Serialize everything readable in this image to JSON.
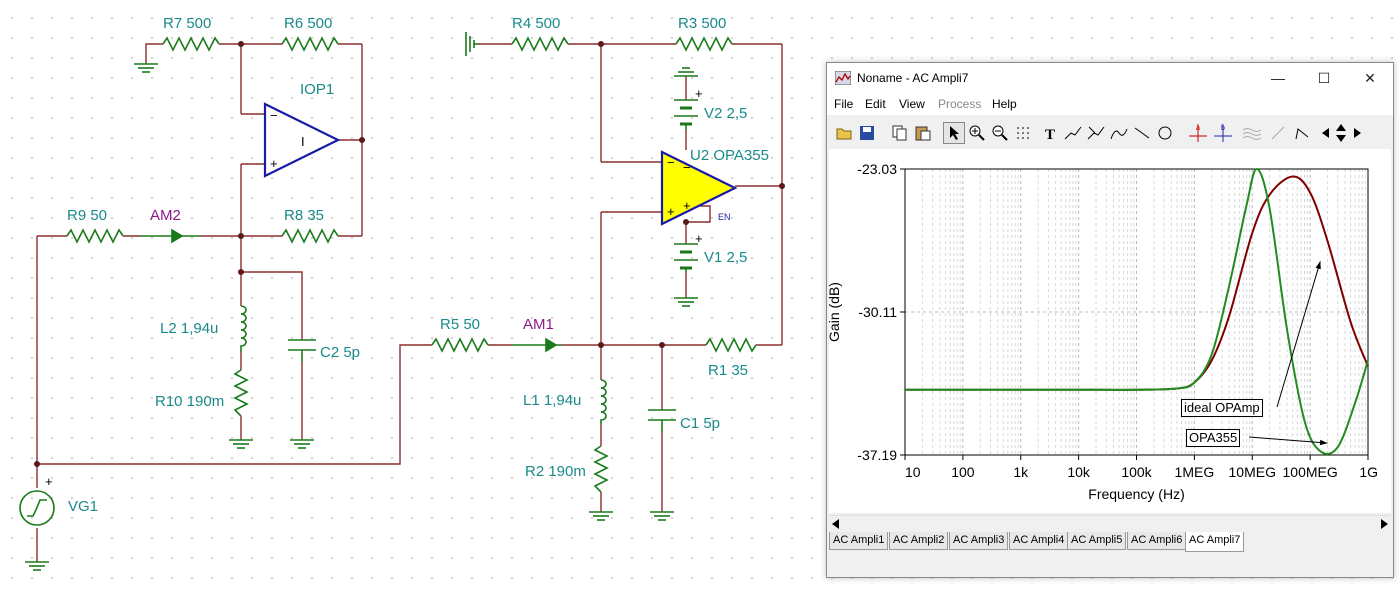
{
  "schematic": {
    "components": {
      "R7": "R7 500",
      "R6": "R6 500",
      "IOP1": "IOP1",
      "R9": "R9 50",
      "AM2": "AM2",
      "R8": "R8 35",
      "L2": "L2 1,94u",
      "C2": "C2 5p",
      "R10": "R10 190m",
      "VG1": "VG1",
      "R4": "R4 500",
      "R3": "R3 500",
      "V2": "V2 2,5",
      "U2": "U2 OPA355",
      "V1": "V1 2,5",
      "R5": "R5 50",
      "AM1": "AM1",
      "R1": "R1 35",
      "L1": "L1 1,94u",
      "C1": "C1 5p",
      "R2": "R2 190m"
    },
    "symbols": {
      "plus": "+",
      "minus": "−",
      "en": "EN",
      "iop_glyph": "I"
    },
    "colors": {
      "wire": "#8b2e2e",
      "label": "#1a8a8a",
      "meter_label": "#8b1a8b",
      "component": "#1a7a1a",
      "opamp_fill": "#ffff00",
      "opamp_stroke": "#1a1aaa"
    }
  },
  "window": {
    "title": "Noname - AC Ampli7",
    "controls": {
      "minimize": "—",
      "maximize": "☐",
      "close": "✕"
    },
    "menu": [
      "File",
      "Edit",
      "View",
      "Process",
      "Help"
    ],
    "menu_disabled": [
      "Process"
    ],
    "toolbar_icons": [
      "open-icon",
      "save-icon",
      "copy-icon",
      "paste-icon",
      "pointer-icon",
      "zoom-in-icon",
      "zoom-out-icon",
      "grid-icon",
      "text-icon",
      "cursor-a-icon",
      "cursor-b-icon",
      "curve-icon",
      "line-icon",
      "circle-icon",
      "cursor-a-cross-icon",
      "cursor-b-cross-icon",
      "waves-icon",
      "arrow-icon",
      "step-icon",
      "scroll-left-icon",
      "scroll-updown-icon",
      "scroll-right-icon"
    ],
    "tabs": [
      "AC Ampli1",
      "AC Ampli2",
      "AC Ampli3",
      "AC Ampli4",
      "AC Ampli5",
      "AC Ampli6",
      "AC Ampli7"
    ],
    "active_tab": "AC Ampli7"
  },
  "chart_data": {
    "type": "line",
    "xlabel": "Frequency (Hz)",
    "ylabel": "Gain (dB)",
    "x_scale": "log",
    "xlim": [
      10,
      1000000000
    ],
    "ylim": [
      -37.19,
      -23.03
    ],
    "x_tick_labels": [
      "10",
      "100",
      "1k",
      "10k",
      "100k",
      "1MEG",
      "10MEG",
      "100MEG",
      "1G"
    ],
    "y_tick_labels": [
      "-23.03",
      "-30.11",
      "-37.19"
    ],
    "grid": true,
    "series": [
      {
        "name": "ideal OPAmp",
        "color": "#800000",
        "x": [
          10,
          100,
          1000,
          10000,
          100000,
          500000,
          1000000,
          2000000,
          4000000,
          10000000,
          20000000,
          50000000,
          100000000,
          200000000,
          500000000,
          1000000000
        ],
        "y": [
          -33.96,
          -33.96,
          -33.96,
          -33.96,
          -33.96,
          -33.9,
          -33.6,
          -32.5,
          -30.3,
          -26.2,
          -24.3,
          -23.4,
          -24.2,
          -26.6,
          -30.6,
          -32.8
        ]
      },
      {
        "name": "OPA355",
        "color": "#228b22",
        "x": [
          10,
          100,
          1000,
          10000,
          100000,
          500000,
          1000000,
          2000000,
          4000000,
          8000000,
          12000000,
          20000000,
          40000000,
          80000000,
          150000000,
          300000000,
          600000000,
          1000000000
        ],
        "y": [
          -33.96,
          -33.96,
          -33.96,
          -33.96,
          -33.96,
          -33.9,
          -33.6,
          -32.2,
          -28.8,
          -24.8,
          -23.03,
          -25.0,
          -31.0,
          -35.5,
          -37.0,
          -36.8,
          -34.6,
          -32.5
        ]
      }
    ],
    "annotations": [
      {
        "label": "ideal OPAmp",
        "series": "ideal OPAmp"
      },
      {
        "label": "OPA355",
        "series": "OPA355"
      }
    ]
  }
}
